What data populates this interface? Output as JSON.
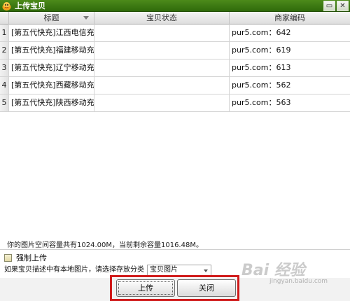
{
  "window": {
    "title": "上传宝贝",
    "minimize_glyph": "▭",
    "close_glyph": "✕",
    "icon": "app-cartoon-icon"
  },
  "table": {
    "columns": [
      "",
      "标题",
      "宝贝状态",
      "商家编码"
    ],
    "rows": [
      {
        "num": "1",
        "title": "[第五代快充]江西电信充...",
        "status": "",
        "code": "pur5.com：642"
      },
      {
        "num": "2",
        "title": "[第五代快充]福建移动充...",
        "status": "",
        "code": "pur5.com：619"
      },
      {
        "num": "3",
        "title": "[第五代快充]辽宁移动充...",
        "status": "",
        "code": "pur5.com：613"
      },
      {
        "num": "4",
        "title": "[第五代快充]西藏移动充...",
        "status": "",
        "code": "pur5.com：562"
      },
      {
        "num": "5",
        "title": "[第五代快充]陕西移动充...",
        "status": "",
        "code": "pur5.com：563"
      }
    ]
  },
  "info": {
    "capacity_text": "你的图片空间容量共有1024.00M，当前剩余容量1016.48M。"
  },
  "options": {
    "force_upload_label": "强制上传",
    "force_upload_checked": false,
    "category_label": "如果宝贝描述中有本地图片，请选择存放分类",
    "category_value": "宝贝图片"
  },
  "buttons": {
    "upload": "上传",
    "close": "关闭"
  },
  "watermark": {
    "text": "Bai 经验",
    "sub": "jingyan.baidu.com"
  },
  "colors": {
    "titlebar": "#3b7a12",
    "highlight": "#d01a1a"
  }
}
